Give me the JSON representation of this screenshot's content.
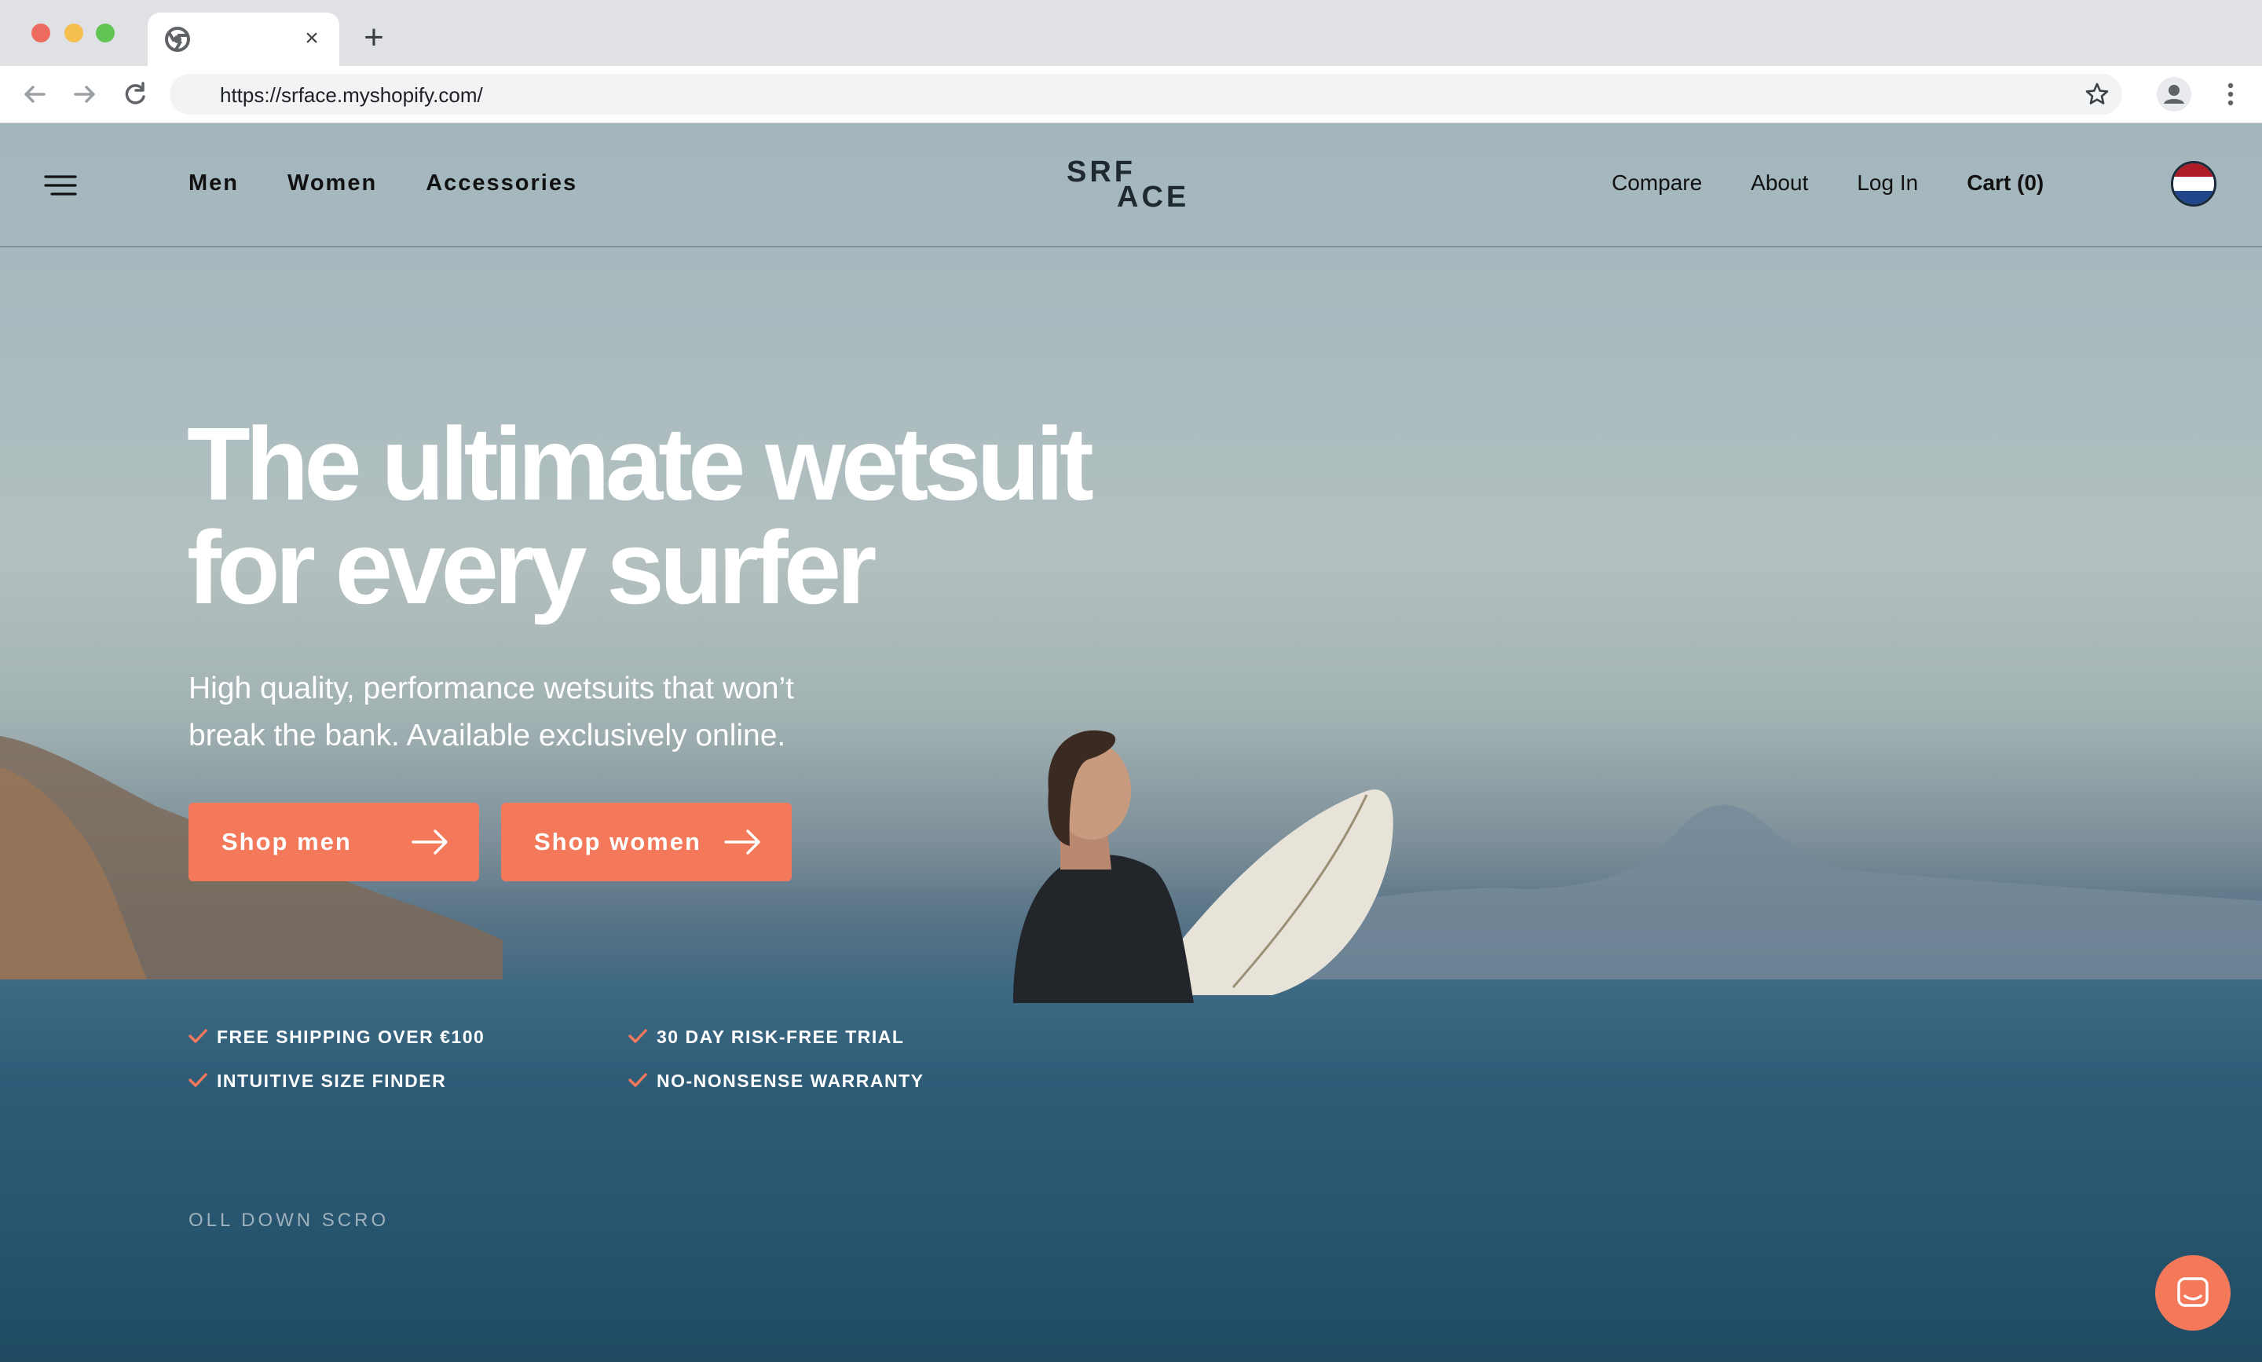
{
  "browser": {
    "url": "https://srface.myshopify.com/",
    "tab_close": "×",
    "new_tab": "+"
  },
  "nav": {
    "left": [
      "Men",
      "Women",
      "Accessories"
    ],
    "right": [
      "Compare",
      "About",
      "Log In"
    ],
    "cart": "Cart (0)"
  },
  "logo": {
    "line1": "SRF",
    "line2": "ACE"
  },
  "hero": {
    "title_line1": "The ultimate wetsuit",
    "title_line2": "for every surfer",
    "subtitle_line1": "High quality, performance wetsuits that won’t",
    "subtitle_line2": "break the bank. Available exclusively online.",
    "cta_men": "Shop men",
    "cta_women": "Shop women"
  },
  "features": [
    "FREE SHIPPING OVER €100",
    "30 DAY RISK-FREE TRIAL",
    "INTUITIVE SIZE FINDER",
    "NO-NONSENSE WARRANTY"
  ],
  "scroll_hint": "OLL DOWN SCROL",
  "colors": {
    "accent": "#f4795b",
    "text_dark": "#111111",
    "hero_text": "#ffffff"
  },
  "icons": {
    "menu": "hamburger-icon",
    "arrow": "arrow-right-icon",
    "check": "check-icon",
    "chat": "chat-icon",
    "flag": "netherlands-flag-icon"
  }
}
